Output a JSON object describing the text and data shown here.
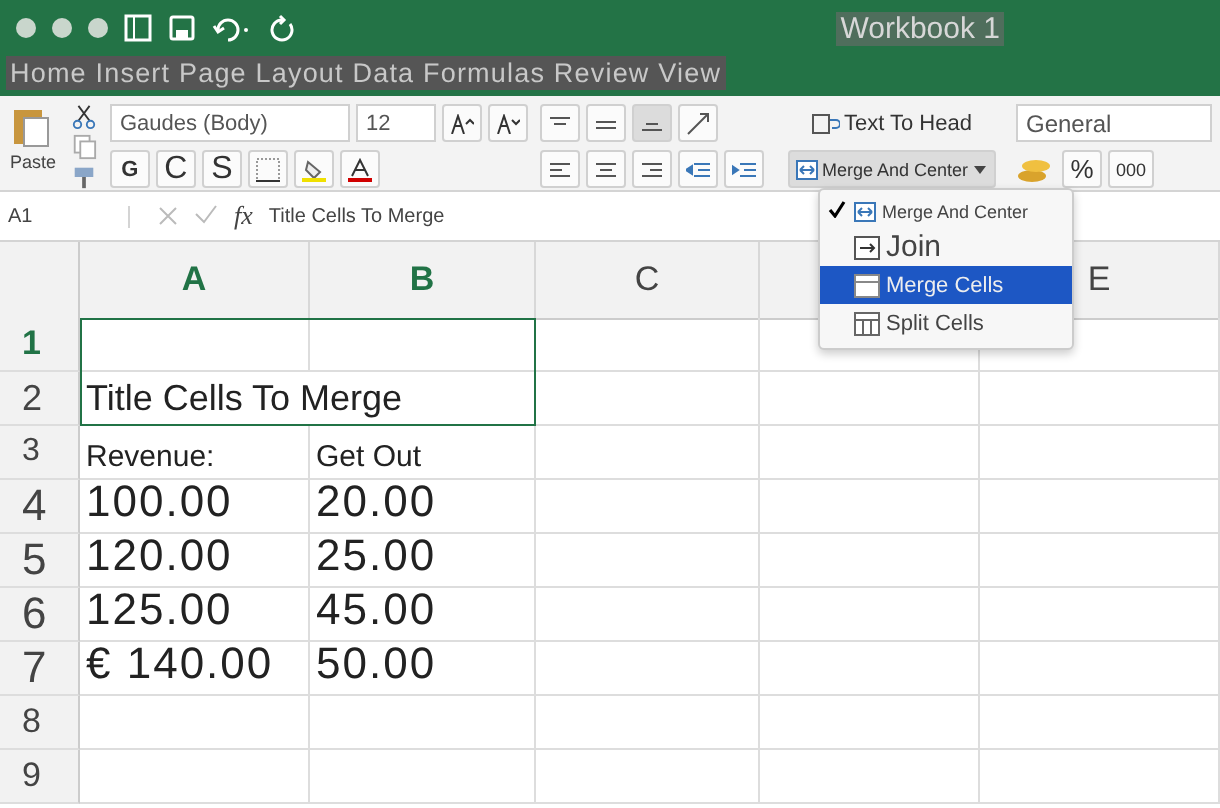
{
  "window": {
    "title": "Workbook 1"
  },
  "menu_tabs": "Home Insert Page Layout Data Formulas Review View",
  "ribbon": {
    "paste_label": "Paste",
    "font_name": "Gaudes (Body)",
    "font_size": "12",
    "bold": "G",
    "italic": "C",
    "underline": "S",
    "wrap_text": "Text To Head",
    "merge_button": "Merge And Center",
    "number_format": "General",
    "percent": "%",
    "thousands": "000"
  },
  "formula_bar": {
    "cell_ref": "A1",
    "fx": "fx",
    "value": "Title Cells To Merge"
  },
  "columns": [
    {
      "label": "A",
      "selected": true
    },
    {
      "label": "B",
      "selected": true
    },
    {
      "label": "C",
      "selected": false
    },
    {},
    {
      "label": "E",
      "selected": false
    }
  ],
  "rows": [
    {
      "number": "1",
      "kind": "empty",
      "selected": true,
      "cells": []
    },
    {
      "number": "2",
      "kind": "title",
      "selected": false,
      "cells": [
        "Title Cells To Merge"
      ]
    },
    {
      "number": "3",
      "kind": "label",
      "selected": false,
      "cells": [
        "Revenue:",
        "Get Out"
      ]
    },
    {
      "number": "4",
      "kind": "value",
      "selected": false,
      "cells": [
        "100.00",
        "20.00"
      ]
    },
    {
      "number": "5",
      "kind": "value",
      "selected": false,
      "cells": [
        "120.00",
        "25.00"
      ]
    },
    {
      "number": "6",
      "kind": "value",
      "selected": false,
      "cells": [
        "125.00",
        "45.00"
      ]
    },
    {
      "number": "7",
      "kind": "value",
      "selected": false,
      "cells": [
        "€  140.00",
        "50.00"
      ]
    },
    {
      "number": "8",
      "kind": "empty",
      "selected": false,
      "cells": []
    },
    {
      "number": "9",
      "kind": "empty",
      "selected": false,
      "cells": []
    }
  ],
  "merge_menu": [
    {
      "label": "Merge And Center",
      "kind": "center",
      "checked": true,
      "selected": false
    },
    {
      "label": "Join",
      "kind": "join",
      "checked": false,
      "selected": false
    },
    {
      "label": "Merge Cells",
      "kind": "merge",
      "checked": false,
      "selected": true
    },
    {
      "label": "Split Cells",
      "kind": "split",
      "checked": false,
      "selected": false
    }
  ]
}
